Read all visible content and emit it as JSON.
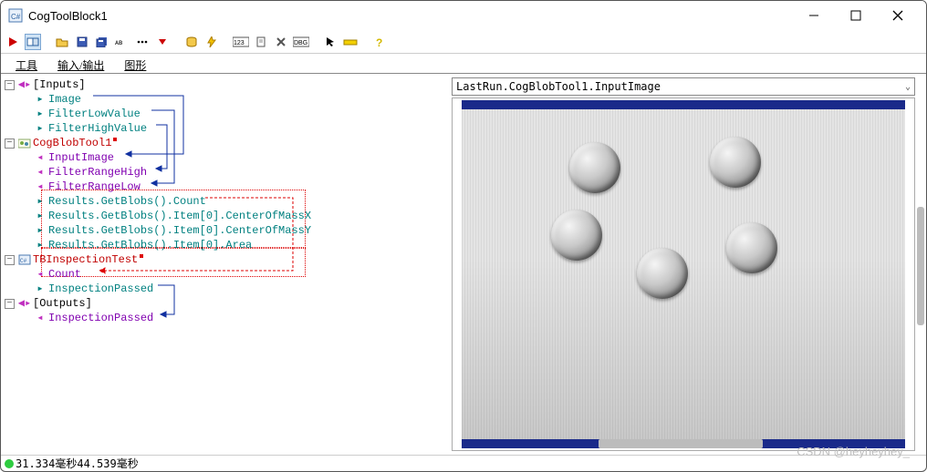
{
  "window": {
    "title": "CogToolBlock1"
  },
  "tabs": {
    "t1": "工具",
    "t2": "输入/输出",
    "t3": "图形"
  },
  "tree": {
    "inputs_label": "[Inputs]",
    "inputs": {
      "image": "Image",
      "flv": "FilterLowValue",
      "fhv": "FilterHighValue"
    },
    "blob": {
      "label": "CogBlobTool1",
      "input_image": "InputImage",
      "frh": "FilterRangeHigh",
      "frl": "FilterRangeLow",
      "r_count": "Results.GetBlobs().Count",
      "r_cx": "Results.GetBlobs().Item[0].CenterOfMassX",
      "r_cy": "Results.GetBlobs().Item[0].CenterOfMassY",
      "r_area": "Results.GetBlobs().Item[0].Area"
    },
    "tb": {
      "label": "TBInspectionTest",
      "count": "Count",
      "passed": "InspectionPassed"
    },
    "outputs_label": "[Outputs]",
    "outputs": {
      "passed": "InspectionPassed"
    }
  },
  "viewer": {
    "path": "LastRun.CogBlobTool1.InputImage"
  },
  "status": {
    "text": "31.334毫秒44.539毫秒"
  },
  "watermark": "CSDN @heyheyhey_"
}
